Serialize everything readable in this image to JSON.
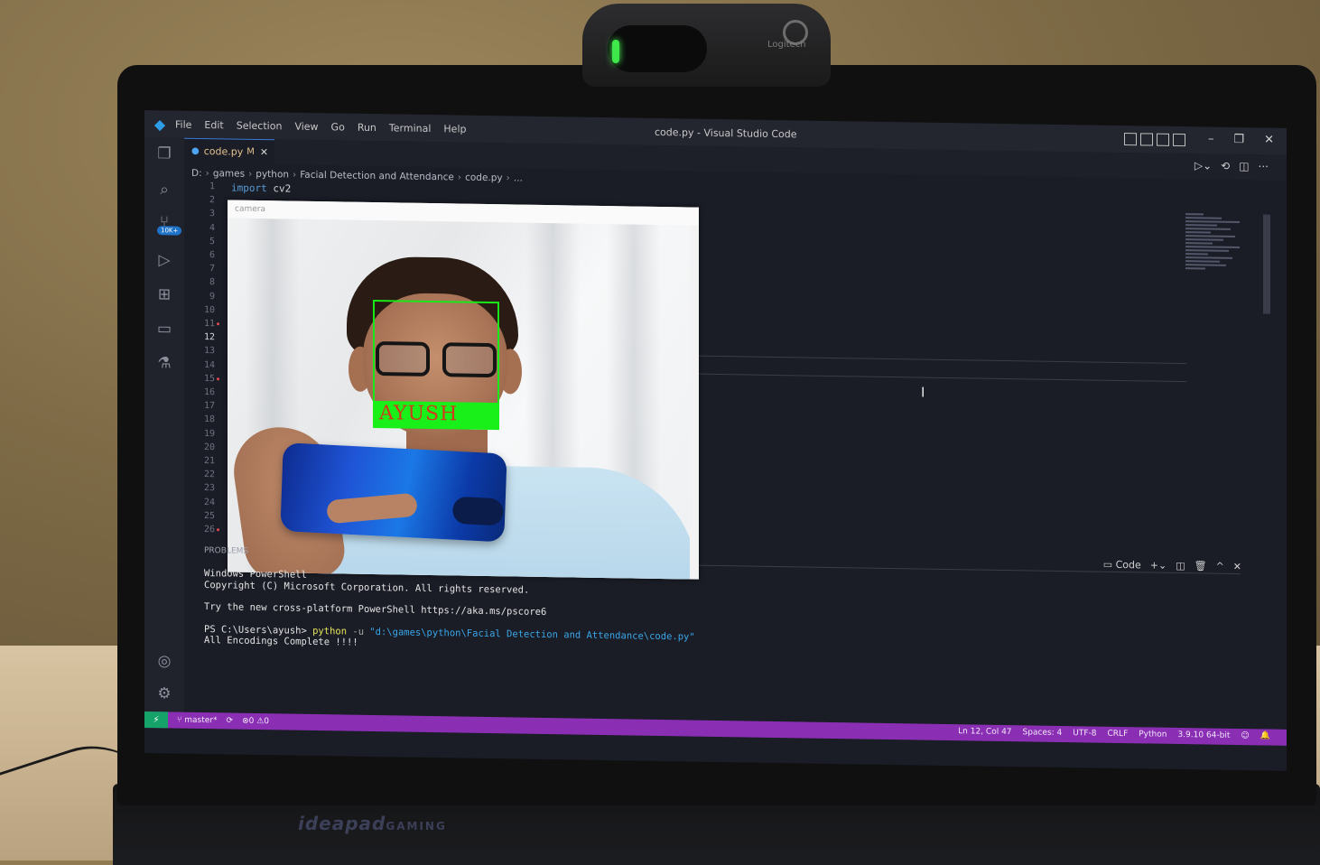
{
  "webcam": {
    "brand": "Logitech"
  },
  "laptop": {
    "brand": "ideapad",
    "brand_suffix": "GAMING"
  },
  "vscode": {
    "menu": [
      "File",
      "Edit",
      "Selection",
      "View",
      "Go",
      "Run",
      "Terminal",
      "Help"
    ],
    "window_title": "code.py - Visual Studio Code",
    "tab": {
      "label": "code.py",
      "modified": "M"
    },
    "breadcrumb": [
      "D:",
      "games",
      "python",
      "Facial Detection and Attendance",
      "code.py",
      "..."
    ],
    "code": {
      "keyword": "import",
      "module": "cv2"
    },
    "line_numbers": [
      "1",
      "2",
      "3",
      "4",
      "5",
      "6",
      "7",
      "8",
      "9",
      "10",
      "11",
      "12",
      "13",
      "14",
      "15",
      "16",
      "17",
      "18",
      "19",
      "20",
      "21",
      "22",
      "23",
      "24",
      "25",
      "26"
    ],
    "active_line": "12",
    "activity_badge": "10K+",
    "panel": {
      "tab_label": "PROBLEMS",
      "terminal_profile": "Code",
      "lines": {
        "l1": "Windows PowerShell",
        "l2": "Copyright (C) Microsoft Corporation. All rights reserved.",
        "l3": "Try the new cross-platform PowerShell https://aka.ms/pscore6",
        "prompt": "PS C:\\Users\\ayush> ",
        "cmd": "python",
        "flag": " -u ",
        "path": "\"d:\\games\\python\\Facial Detection and Attendance\\code.py\"",
        "l5": "All Encodings Complete !!!!"
      }
    },
    "status": {
      "branch": "master*",
      "errors": "0",
      "warnings": "0",
      "position": "Ln 12, Col 47",
      "spaces": "Spaces: 4",
      "encoding": "UTF-8",
      "eol": "CRLF",
      "language": "Python",
      "interpreter": "3.9.10 64-bit"
    },
    "camera_window": {
      "title": "camera",
      "detected_name": "AYUSH",
      "box_color": "#19e819",
      "label_color": "#d03b1c"
    }
  }
}
